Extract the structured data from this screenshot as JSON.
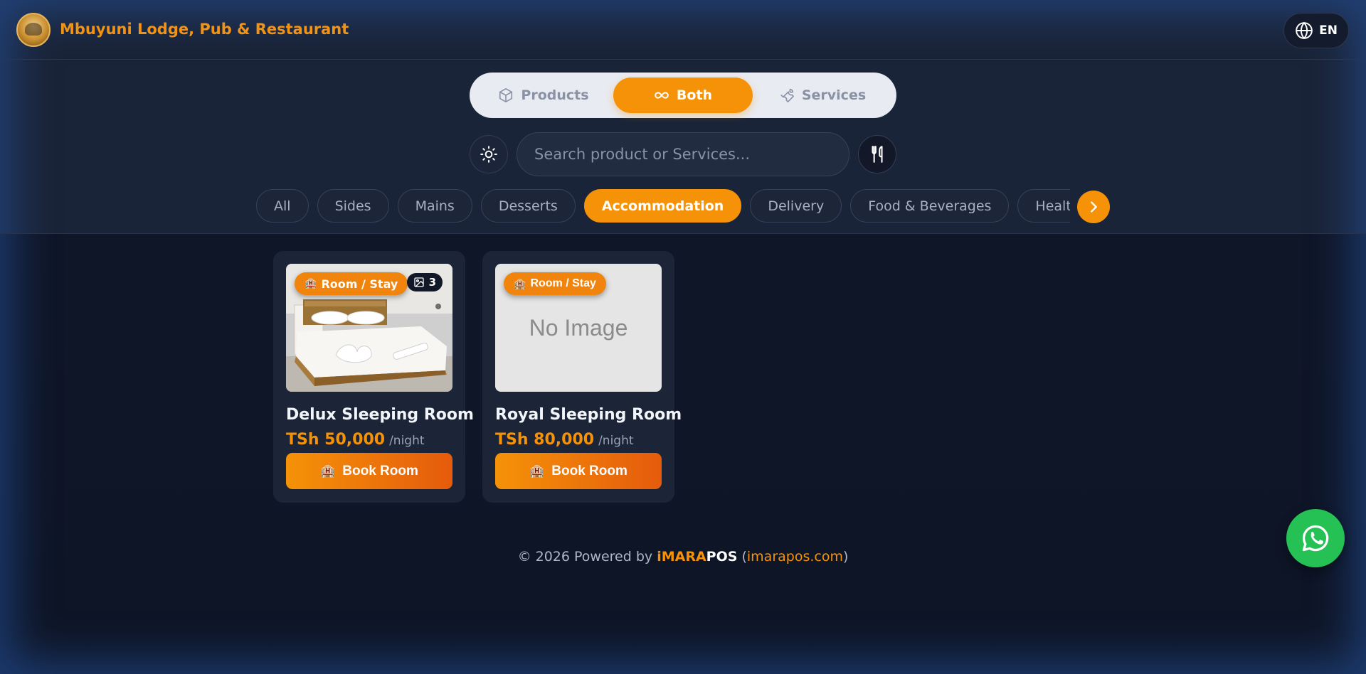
{
  "header": {
    "brand": "Mbuyuni Lodge, Pub & Restaurant",
    "language": "EN"
  },
  "mode_toggle": {
    "products": "Products",
    "both": "Both",
    "services": "Services",
    "selected": "Both"
  },
  "search": {
    "placeholder": "Search product or Services..."
  },
  "categories": {
    "items": [
      "All",
      "Sides",
      "Mains",
      "Desserts",
      "Accommodation",
      "Delivery",
      "Food & Beverages",
      "Health & Beauty"
    ],
    "selected": "Accommodation"
  },
  "cards": [
    {
      "tag": "Room / Stay",
      "image_count": "3",
      "title": "Delux Sleeping Room",
      "price": "TSh 50,000",
      "unit": "/night",
      "button": "Book Room"
    },
    {
      "tag": "Room / Stay",
      "no_image": "No Image",
      "title": "Royal Sleeping Room",
      "price": "TSh 80,000",
      "unit": "/night",
      "button": "Book Room"
    }
  ],
  "footer": {
    "prefix": "© 2026 Powered by ",
    "brand_a": "iMARA",
    "brand_b": "POS",
    "open_paren": " (",
    "link": "imarapos.com",
    "close_paren": ")"
  },
  "colors": {
    "accent": "#f59208",
    "background": "#0f1628",
    "whatsapp": "#25c155"
  },
  "icons": [
    "globe-icon",
    "cube-icon",
    "infinity-icon",
    "wrench-icon",
    "sun-icon",
    "utensils-icon",
    "chevron-right-icon",
    "hotel-icon",
    "image-icon",
    "whatsapp-icon"
  ]
}
